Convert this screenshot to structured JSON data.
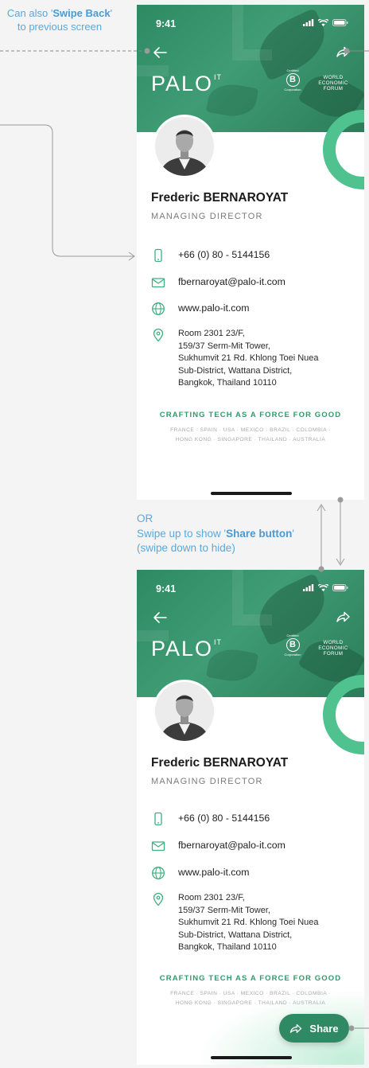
{
  "annotations": {
    "top_line1_pre": "Can also '",
    "top_line1_bold": "Swipe Back",
    "top_line1_post": "'",
    "top_line2": "to previous screen",
    "mid_line1": "OR",
    "mid_line2_pre": "Swipe up to show '",
    "mid_line2_bold": "Share button",
    "mid_line2_post": "'",
    "mid_line3": "(swipe down to hide)"
  },
  "status": {
    "time": "9:41"
  },
  "brand": {
    "logo": "PALO",
    "logo_sup": "IT",
    "bcorp_top": "Certified",
    "bcorp_letter": "B",
    "bcorp_bottom": "Corporation",
    "wef_1": "WORLD",
    "wef_2": "ECONOMIC",
    "wef_3": "FORUM"
  },
  "profile": {
    "name": "Frederic BERNAROYAT",
    "title": "MANAGING DIRECTOR",
    "phone": "+66 (0) 80 - 5144156",
    "email": "fbernaroyat@palo-it.com",
    "website": "www.palo-it.com",
    "address": [
      "Room 2301 23/F,",
      "159/37 Serm-Mit Tower,",
      "Sukhumvit 21 Rd. Khlong Toei Nuea",
      "Sub-District, Wattana District,",
      "Bangkok, Thailand 10110"
    ]
  },
  "footer": {
    "tagline": "CRAFTING TECH AS A FORCE FOR GOOD",
    "countries_1": "FRANCE · SPAIN · USA · MEXICO · BRAZIL · COLOMBIA ·",
    "countries_2": "HONG KONG · SINGAPORE · THAILAND · AUSTRALIA"
  },
  "share_button": {
    "label": "Share"
  },
  "colors": {
    "brand_green": "#2f8a63",
    "accent_green": "#4fc28f",
    "annotation_blue": "#5aa8de"
  }
}
